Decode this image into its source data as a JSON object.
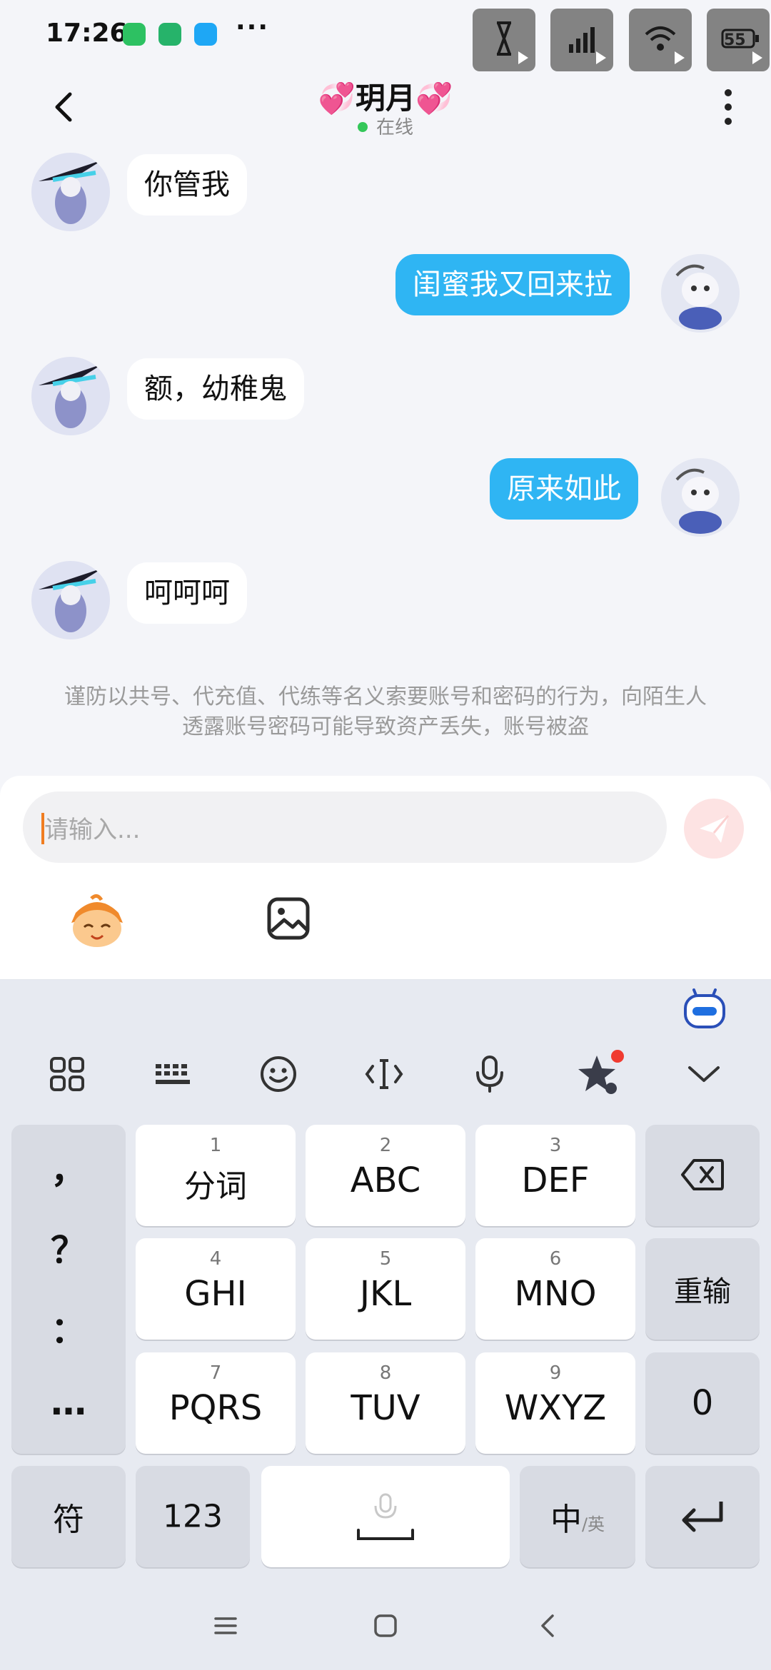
{
  "status_bar": {
    "time": "17:26",
    "more": "···",
    "battery": "55",
    "app_icons": [
      "wechat-icon",
      "security-icon",
      "message-app-icon"
    ],
    "system_icons": [
      "bluetooth-icon",
      "hd-signal-icon",
      "signal-icon",
      "wifi-icon",
      "battery-icon"
    ]
  },
  "header": {
    "title": "💞玥月💞",
    "status": "在线",
    "back_icon": "chevron-left-icon",
    "more_icon": "more-vertical-icon"
  },
  "messages": [
    {
      "side": "in",
      "text": "你管我"
    },
    {
      "side": "out",
      "text": "闺蜜我又回来拉"
    },
    {
      "side": "in",
      "text": "额，幼稚鬼"
    },
    {
      "side": "out",
      "text": "原来如此"
    },
    {
      "side": "in",
      "text": "呵呵呵"
    }
  ],
  "notice": "谨防以共号、代充值、代练等名义索要账号和密码的行为，向陌生人透露账号密码可能导致资产丢失，账号被盗",
  "composer": {
    "placeholder": "请输入...",
    "send_icon": "send-icon",
    "tools": [
      "mascot-sticker-icon",
      "image-icon"
    ]
  },
  "keyboard": {
    "toolbar_icons": [
      "grid-menu-icon",
      "keyboard-icon",
      "emoji-icon",
      "cursor-icon",
      "mic-icon",
      "ai-star-icon",
      "collapse-icon"
    ],
    "punctuation": [
      "，",
      "？",
      "：",
      "…"
    ],
    "keys": {
      "k1": {
        "num": "1",
        "label": "分词"
      },
      "k2": {
        "num": "2",
        "label": "ABC"
      },
      "k3": {
        "num": "3",
        "label": "DEF"
      },
      "k4": {
        "num": "4",
        "label": "GHI"
      },
      "k5": {
        "num": "5",
        "label": "JKL"
      },
      "k6": {
        "num": "6",
        "label": "MNO"
      },
      "k7": {
        "num": "7",
        "label": "PQRS"
      },
      "k8": {
        "num": "8",
        "label": "TUV"
      },
      "k9": {
        "num": "9",
        "label": "WXYZ"
      }
    },
    "backspace_icon": "backspace-icon",
    "reenter": "重输",
    "zero": "0",
    "symbols": "符",
    "numbers": "123",
    "lang_main": "中",
    "lang_sub": "/英",
    "enter_icon": "enter-icon"
  },
  "navbar": {
    "icons": [
      "menu-icon",
      "home-icon",
      "back-icon"
    ]
  }
}
